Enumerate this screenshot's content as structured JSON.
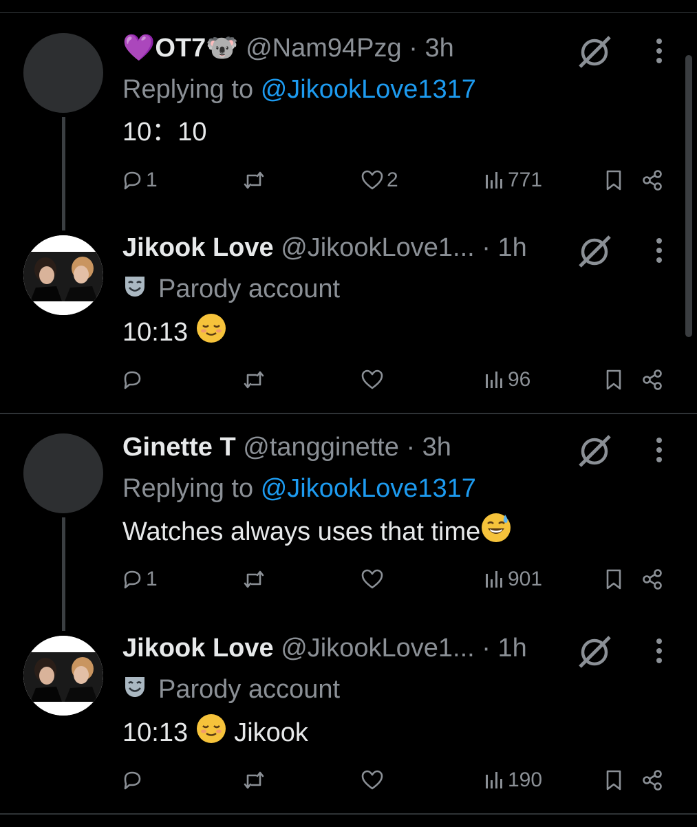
{
  "tweets": [
    {
      "name": "💜OT7🐨",
      "handle": "@Nam94Pzg",
      "time": "· 3h",
      "replying_prefix": "Replying to",
      "replying_to": "@JikookLove1317",
      "text": "10：10",
      "replies": "1",
      "retweets": "",
      "likes": "2",
      "views": "771"
    },
    {
      "name": "Jikook Love",
      "handle": "@JikookLove1...",
      "time": "· 1h",
      "badge": "Parody account",
      "text": "10:13",
      "emoji": "😌",
      "replies": "",
      "retweets": "",
      "likes": "",
      "views": "96"
    },
    {
      "name": "Ginette T",
      "handle": "@tangginette",
      "time": "· 3h",
      "replying_prefix": "Replying to",
      "replying_to": "@JikookLove1317",
      "text": "Watches always uses that time",
      "emoji": "😅",
      "replies": "1",
      "retweets": "",
      "likes": "",
      "views": "901"
    },
    {
      "name": "Jikook Love",
      "handle": "@JikookLove1...",
      "time": "· 1h",
      "badge": "Parody account",
      "text": "10:13",
      "emoji": "😌",
      "text_after": "Jikook",
      "replies": "",
      "retweets": "",
      "likes": "",
      "views": "190"
    }
  ],
  "colors": {
    "background": "#000000",
    "text": "#e7e9ea",
    "muted": "#8b9096",
    "link": "#1d9bf0",
    "divider": "#2f3336"
  }
}
